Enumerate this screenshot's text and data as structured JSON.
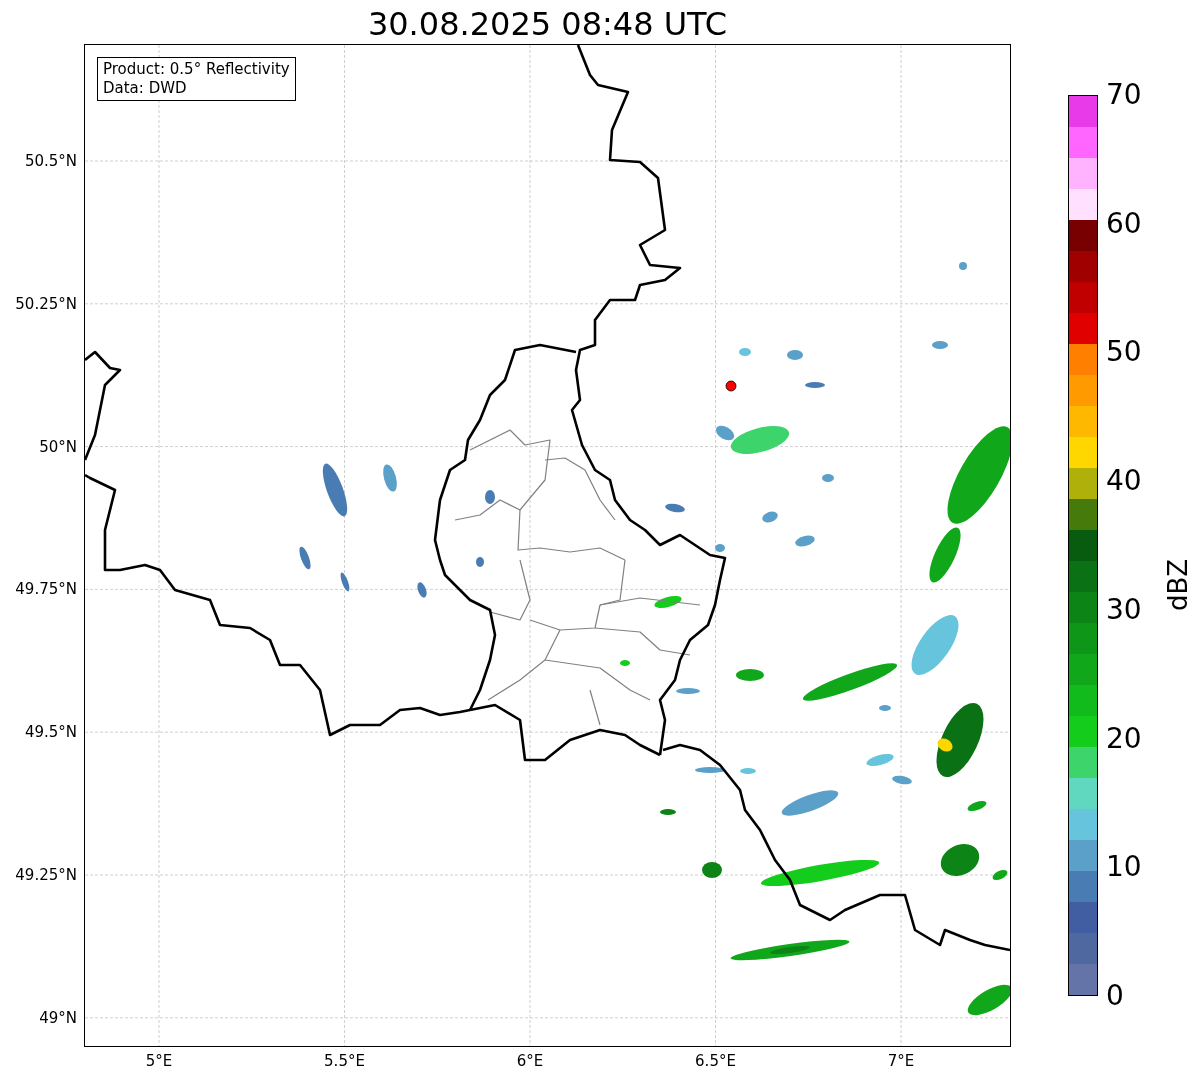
{
  "title": "30.08.2025 08:48 UTC",
  "info_box": {
    "lines": [
      "Product: 0.5° Reflectivity",
      "Data: DWD"
    ]
  },
  "map": {
    "lat_ticks": [
      "50.5°N",
      "50.25°N",
      "50°N",
      "49.75°N",
      "49.5°N",
      "49.25°N",
      "49°N"
    ],
    "lon_ticks": [
      "5°E",
      "5.5°E",
      "6°E",
      "6.5°E",
      "7°E"
    ]
  },
  "colorbar": {
    "label": "dBZ",
    "ticks": [
      "70",
      "60",
      "50",
      "40",
      "30",
      "20",
      "10",
      "0"
    ],
    "segments": [
      {
        "color": "#e83ae8"
      },
      {
        "color": "#ff66ff"
      },
      {
        "color": "#ffb3ff"
      },
      {
        "color": "#ffe0ff"
      },
      {
        "color": "#780000"
      },
      {
        "color": "#a00000"
      },
      {
        "color": "#c00000"
      },
      {
        "color": "#e00000"
      },
      {
        "color": "#ff8000"
      },
      {
        "color": "#ff9a00"
      },
      {
        "color": "#ffb800"
      },
      {
        "color": "#ffd700"
      },
      {
        "color": "#b0b00a"
      },
      {
        "color": "#467a0a"
      },
      {
        "color": "#085c10"
      },
      {
        "color": "#0a7214"
      },
      {
        "color": "#0c8416"
      },
      {
        "color": "#0e9618"
      },
      {
        "color": "#10a81a"
      },
      {
        "color": "#12bb1c"
      },
      {
        "color": "#14cc1c"
      },
      {
        "color": "#3dd46c"
      },
      {
        "color": "#60d8c0"
      },
      {
        "color": "#66c4dc"
      },
      {
        "color": "#5aa0c8"
      },
      {
        "color": "#4a7cb4"
      },
      {
        "color": "#415ea3"
      },
      {
        "color": "#5068a0"
      },
      {
        "color": "#6474a8"
      }
    ]
  }
}
